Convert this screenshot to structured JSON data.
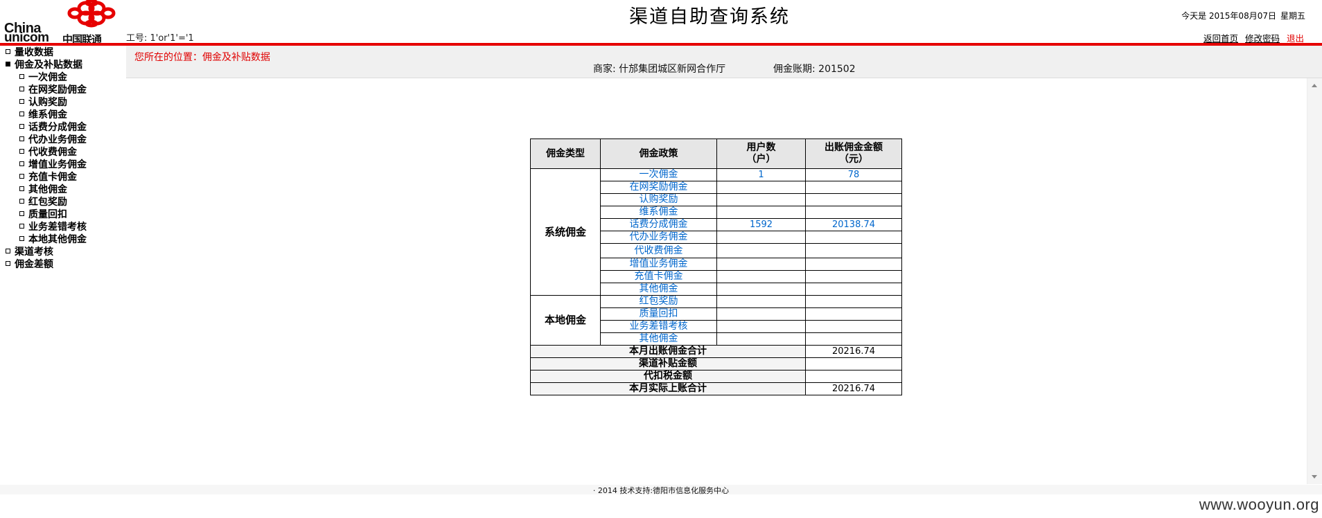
{
  "header": {
    "logo_en_1": "China",
    "logo_en_2": "unicom",
    "logo_cn": "中国联通",
    "user_label": "工号: 1'or'1'='1",
    "title": "渠道自助查询系统",
    "date_text": "今天是 2015年08月07日",
    "weekday": "星期五",
    "links": {
      "home": "返回首页",
      "change_password": "修改密码",
      "logout": "退出"
    }
  },
  "colors": {
    "accent_red": "#e60000",
    "link_blue": "#0066cc"
  },
  "sidebar": {
    "items": [
      {
        "label": "量收数据",
        "level": 1,
        "expanded": false
      },
      {
        "label": "佣金及补贴数据",
        "level": 1,
        "expanded": true
      },
      {
        "label": "一次佣金",
        "level": 2
      },
      {
        "label": "在网奖励佣金",
        "level": 2
      },
      {
        "label": "认购奖励",
        "level": 2
      },
      {
        "label": "维系佣金",
        "level": 2
      },
      {
        "label": "话费分成佣金",
        "level": 2
      },
      {
        "label": "代办业务佣金",
        "level": 2
      },
      {
        "label": "代收费佣金",
        "level": 2
      },
      {
        "label": "增值业务佣金",
        "level": 2
      },
      {
        "label": "充值卡佣金",
        "level": 2
      },
      {
        "label": "其他佣金",
        "level": 2
      },
      {
        "label": "红包奖励",
        "level": 2
      },
      {
        "label": "质量回扣",
        "level": 2
      },
      {
        "label": "业务差错考核",
        "level": 2
      },
      {
        "label": "本地其他佣金",
        "level": 2
      },
      {
        "label": "渠道考核",
        "level": 1,
        "expanded": false
      },
      {
        "label": "佣金差额",
        "level": 1,
        "expanded": false
      }
    ]
  },
  "main": {
    "breadcrumb": "您所在的位置：佣金及补贴数据",
    "merchant": "商家:  什邡集团城区新网合作厅",
    "period": "佣金账期: 201502"
  },
  "table": {
    "headers": [
      "佣金类型",
      "佣金政策",
      "用户数\n（户）",
      "出账佣金金额\n（元）"
    ],
    "groups": [
      {
        "category": "系统佣金",
        "rows": [
          {
            "policy": "一次佣金",
            "users": "1",
            "amount": "78"
          },
          {
            "policy": "在网奖励佣金",
            "users": "",
            "amount": ""
          },
          {
            "policy": "认购奖励",
            "users": "",
            "amount": ""
          },
          {
            "policy": "维系佣金",
            "users": "",
            "amount": ""
          },
          {
            "policy": "话费分成佣金",
            "users": "1592",
            "amount": "20138.74"
          },
          {
            "policy": "代办业务佣金",
            "users": "",
            "amount": ""
          },
          {
            "policy": "代收费佣金",
            "users": "",
            "amount": ""
          },
          {
            "policy": "增值业务佣金",
            "users": "",
            "amount": ""
          },
          {
            "policy": "充值卡佣金",
            "users": "",
            "amount": ""
          },
          {
            "policy": "其他佣金",
            "users": "",
            "amount": ""
          }
        ]
      },
      {
        "category": "本地佣金",
        "rows": [
          {
            "policy": "红包奖励",
            "users": "",
            "amount": ""
          },
          {
            "policy": "质量回扣",
            "users": "",
            "amount": ""
          },
          {
            "policy": "业务差错考核",
            "users": "",
            "amount": ""
          },
          {
            "policy": "其他佣金",
            "users": "",
            "amount": ""
          }
        ]
      }
    ],
    "summary": [
      {
        "label": "本月出账佣金合计",
        "amount": "20216.74"
      },
      {
        "label": "渠道补贴金额",
        "amount": ""
      },
      {
        "label": "代扣税金额",
        "amount": ""
      },
      {
        "label": "本月实际上账合计",
        "amount": "20216.74"
      }
    ]
  },
  "footer": {
    "text": "· 2014 技术支持:德阳市信息化服务中心"
  },
  "watermark": "www.wooyun.org"
}
